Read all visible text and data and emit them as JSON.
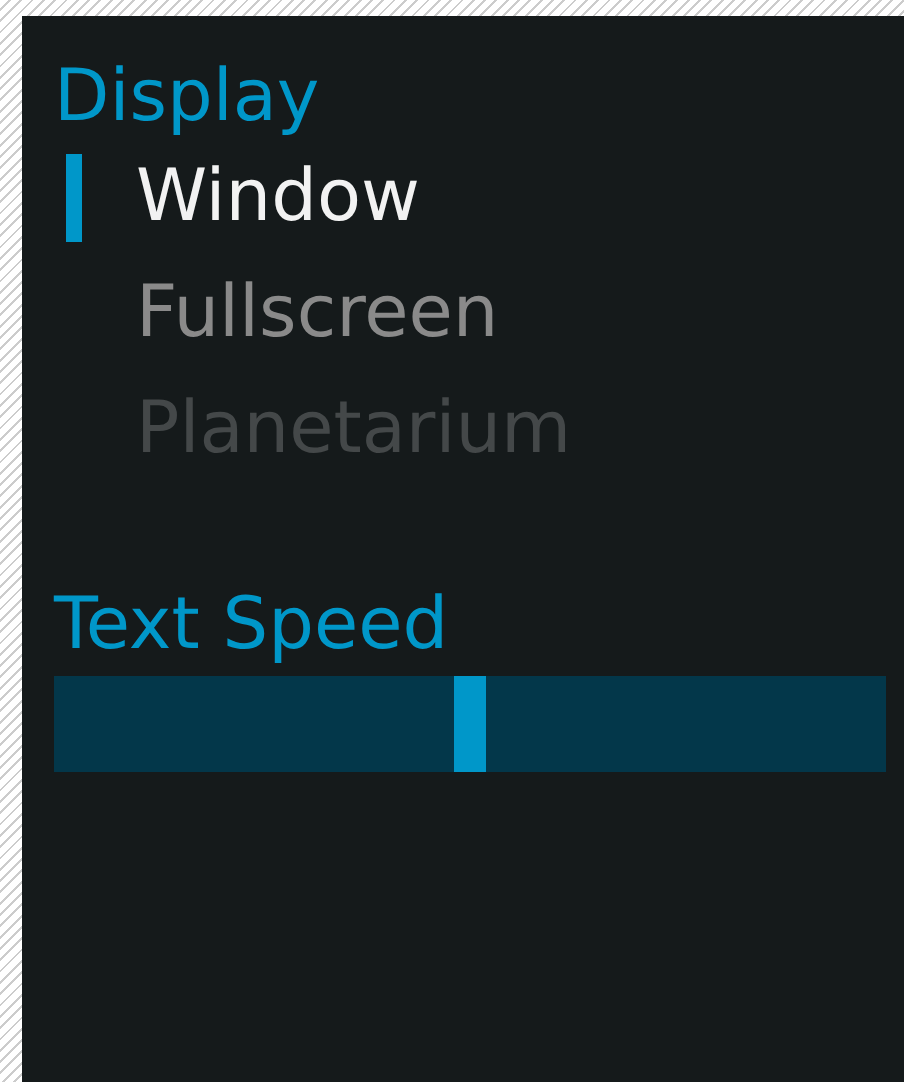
{
  "display": {
    "title": "Display",
    "options": [
      {
        "label": "Window",
        "selected": true,
        "disabled": false
      },
      {
        "label": "Fullscreen",
        "selected": false,
        "disabled": false
      },
      {
        "label": "Planetarium",
        "selected": false,
        "disabled": true
      }
    ]
  },
  "text_speed": {
    "title": "Text Speed",
    "level": 0.5
  }
}
